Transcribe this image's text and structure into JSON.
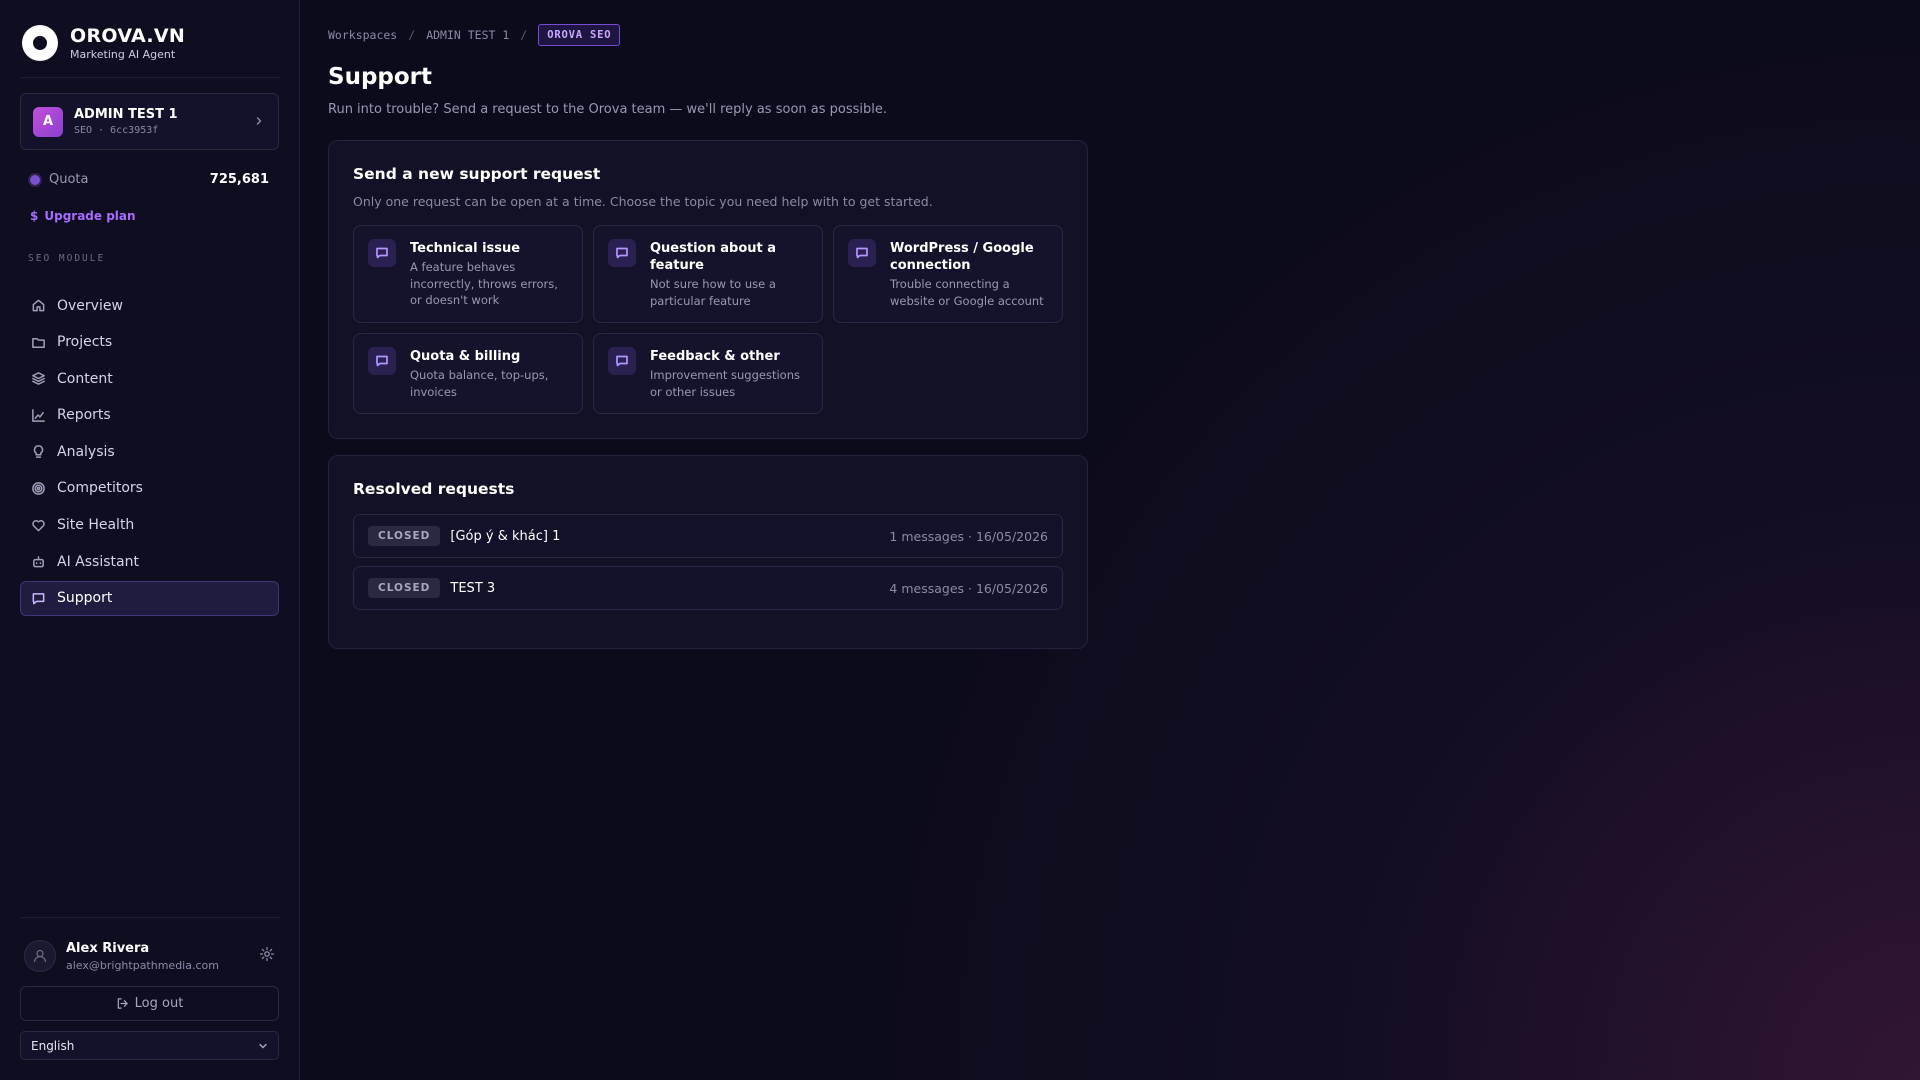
{
  "brand": {
    "name": "OROVA.VN",
    "subtitle": "Marketing AI Agent"
  },
  "workspace": {
    "avatar": "A",
    "name": "ADMIN TEST 1",
    "meta": "SEO · 6cc3953f"
  },
  "quota": {
    "label": "Quota",
    "value": "725,681"
  },
  "upgrade": {
    "label": "Upgrade plan",
    "icon": "dollar-icon"
  },
  "section_title": "SEO MODULE",
  "nav": [
    {
      "label": "Overview",
      "icon": "home-icon"
    },
    {
      "label": "Projects",
      "icon": "folder-icon"
    },
    {
      "label": "Content",
      "icon": "layers-icon"
    },
    {
      "label": "Reports",
      "icon": "chart-icon"
    },
    {
      "label": "Analysis",
      "icon": "bulb-icon"
    },
    {
      "label": "Competitors",
      "icon": "target-icon"
    },
    {
      "label": "Site Health",
      "icon": "heart-icon"
    },
    {
      "label": "AI Assistant",
      "icon": "bot-icon"
    },
    {
      "label": "Support",
      "icon": "chat-icon",
      "active": true
    }
  ],
  "user": {
    "name": "Alex Rivera",
    "email": "alex@brightpathmedia.com"
  },
  "logout_label": "Log out",
  "language": "English",
  "breadcrumb": {
    "first": "Workspaces",
    "second": "ADMIN TEST 1",
    "current": "OROVA SEO"
  },
  "page": {
    "title": "Support",
    "subtitle": "Run into trouble? Send a request to the Orova team — we'll reply as soon as possible."
  },
  "new_request": {
    "title": "Send a new support request",
    "subtitle": "Only one request can be open at a time. Choose the topic you need help with to get started.",
    "topics": [
      {
        "title": "Technical issue",
        "desc": "A feature behaves incorrectly, throws errors, or doesn't work"
      },
      {
        "title": "Question about a feature",
        "desc": "Not sure how to use a particular feature"
      },
      {
        "title": "WordPress / Google connection",
        "desc": "Trouble connecting a website or Google account"
      },
      {
        "title": "Quota & billing",
        "desc": "Quota balance, top-ups, invoices"
      },
      {
        "title": "Feedback & other",
        "desc": "Improvement suggestions or other issues"
      }
    ]
  },
  "resolved": {
    "title": "Resolved requests",
    "items": [
      {
        "status": "CLOSED",
        "title": "[Góp ý & khác] 1",
        "meta": "1 messages · 16/05/2026"
      },
      {
        "status": "CLOSED",
        "title": "TEST 3",
        "meta": "4 messages · 16/05/2026"
      }
    ]
  },
  "colors": {
    "accent": "#a66cff",
    "background": "#0c0b1c",
    "sidebar": "#0f0e21"
  }
}
